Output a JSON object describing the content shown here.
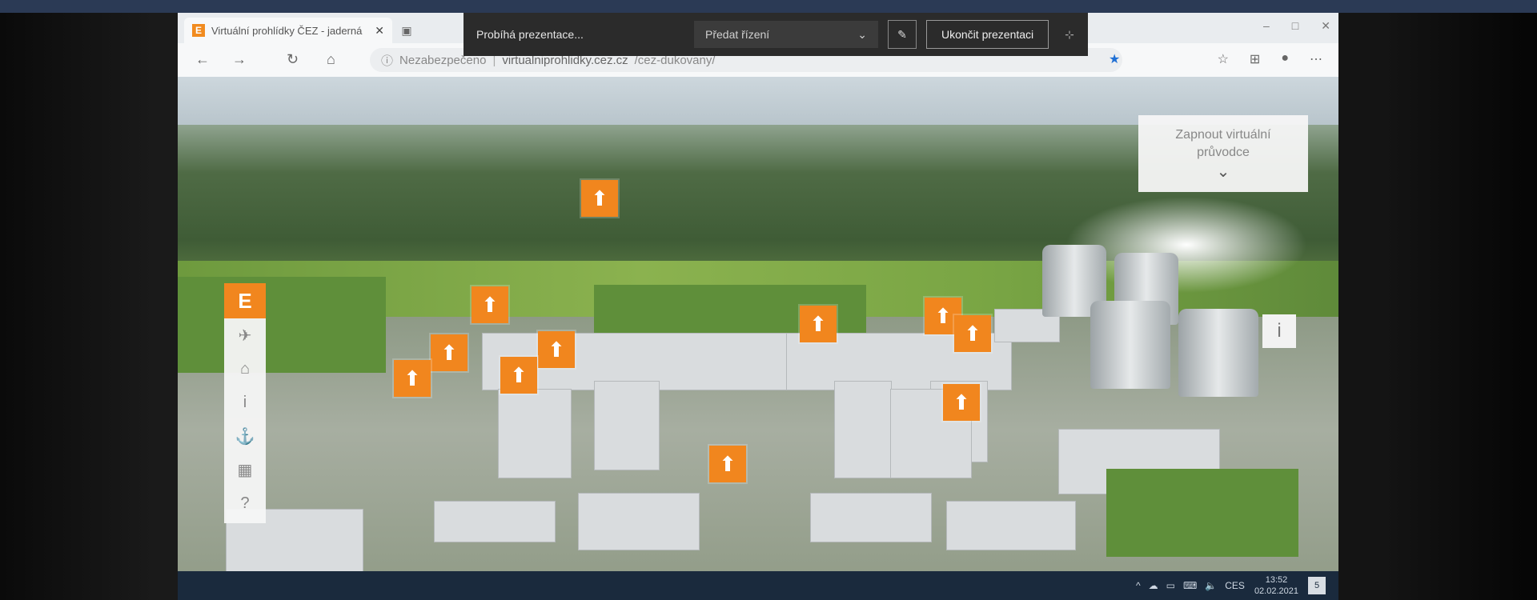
{
  "top_strip": {
    "text": ""
  },
  "browser": {
    "tab_title": "Virtuální prohlídky ČEZ - jaderná",
    "tab_close": "✕",
    "url_security": "Nezabezpečeno",
    "url_sep": "|",
    "url_host": "virtualniprohlidky.cez.cz",
    "url_path": "/cez-dukovany/",
    "window_controls": [
      "–",
      "□",
      "✕"
    ]
  },
  "presentation": {
    "status": "Probíhá prezentace...",
    "handover_label": "Předat řízení",
    "end_label": "Ukončit prezentaci",
    "pin": "⊹"
  },
  "tour": {
    "guide_label_line1": "Zapnout virtuální",
    "guide_label_line2": "průvodce",
    "info_label": "i",
    "logo": "E",
    "sidebar": [
      "✈",
      "⌂",
      "i",
      "⚓",
      "▦",
      "?"
    ],
    "hotspot_glyph": "⬆",
    "colors": {
      "accent": "#f1861e"
    }
  },
  "taskbar": {
    "language": "CES",
    "time": "13:52",
    "date": "02.02.2021",
    "notifications": "5"
  }
}
